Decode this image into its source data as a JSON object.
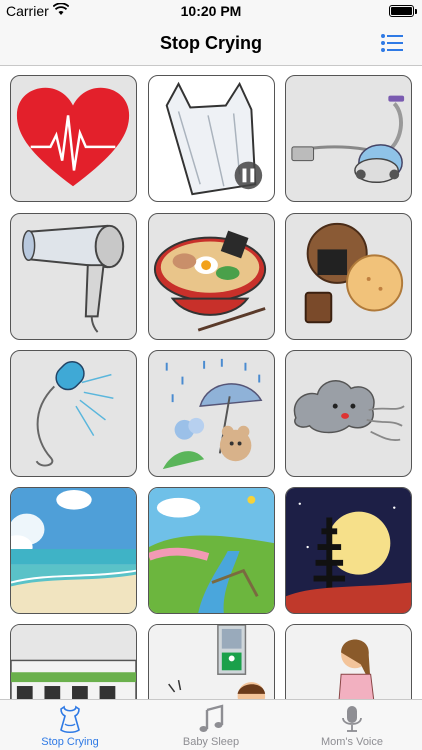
{
  "status_bar": {
    "carrier": "Carrier",
    "time": "10:20 PM"
  },
  "nav": {
    "title": "Stop Crying",
    "menu_icon": "list-menu-icon"
  },
  "grid": {
    "tiles": [
      {
        "name": "heartbeat",
        "playing": false
      },
      {
        "name": "plastic-bag",
        "playing": true
      },
      {
        "name": "vacuum-cleaner",
        "playing": false
      },
      {
        "name": "hair-dryer",
        "playing": false
      },
      {
        "name": "ramen",
        "playing": false
      },
      {
        "name": "rice-crackers",
        "playing": false
      },
      {
        "name": "shower",
        "playing": false
      },
      {
        "name": "rain",
        "playing": false
      },
      {
        "name": "wind",
        "playing": false
      },
      {
        "name": "beach",
        "playing": false
      },
      {
        "name": "river",
        "playing": false
      },
      {
        "name": "night-pagoda",
        "playing": false
      },
      {
        "name": "train",
        "playing": false
      },
      {
        "name": "crossing-signal",
        "playing": false
      },
      {
        "name": "ticket-gate",
        "playing": false
      }
    ]
  },
  "tabbar": {
    "tabs": [
      {
        "label": "Stop Crying",
        "icon": "bib-icon",
        "active": true
      },
      {
        "label": "Baby Sleep",
        "icon": "music-note-icon",
        "active": false
      },
      {
        "label": "Mom's Voice",
        "icon": "microphone-icon",
        "active": false
      }
    ]
  },
  "colors": {
    "accent": "#2f7ae5",
    "inactive": "#8e8e93"
  }
}
